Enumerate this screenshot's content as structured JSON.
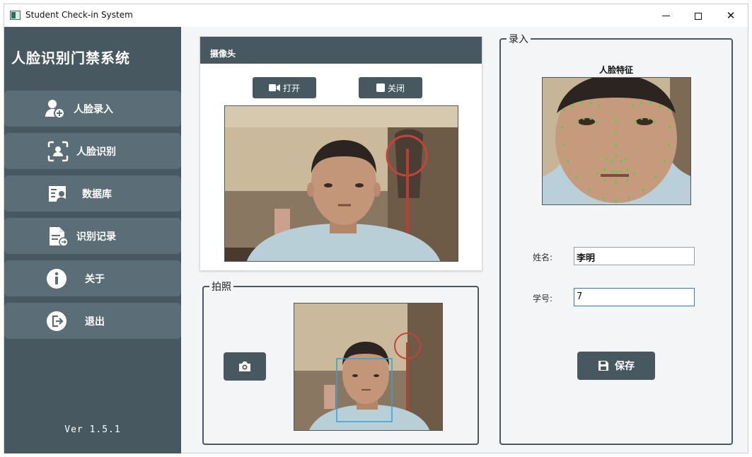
{
  "window": {
    "title": "Student Check-in System",
    "min": "–",
    "max": "□",
    "close": "✕"
  },
  "sidebar": {
    "title": "人脸识别门禁系统",
    "items": [
      {
        "label": "人脸录入",
        "icon": "user-add-icon"
      },
      {
        "label": "人脸识别",
        "icon": "face-scan-icon"
      },
      {
        "label": "数据库",
        "icon": "database-card-icon"
      },
      {
        "label": "识别记录",
        "icon": "record-file-icon"
      },
      {
        "label": "关于",
        "icon": "info-icon"
      },
      {
        "label": "退出",
        "icon": "logout-icon"
      }
    ],
    "version": "Ver 1.5.1"
  },
  "camera": {
    "title": "摄像头",
    "open_label": "打开",
    "close_label": "关闭"
  },
  "snapshot": {
    "title": "拍照"
  },
  "enroll": {
    "title": "录入",
    "feature_label": "人脸特征",
    "name_label": "姓名:",
    "name_value": "李明",
    "id_label": "学号:",
    "id_value": "7",
    "save_label": "保存"
  },
  "colors": {
    "sidebar": "#475861",
    "nav_item": "#5b6d76",
    "accent_box": "#2aa6d8",
    "landmark": "#3ddc3d"
  }
}
